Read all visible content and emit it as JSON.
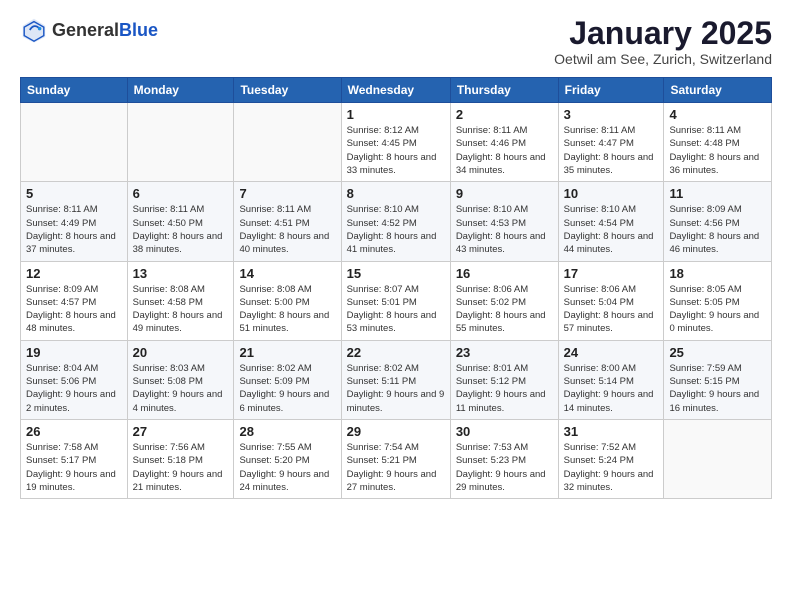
{
  "header": {
    "logo_general": "General",
    "logo_blue": "Blue",
    "month_title": "January 2025",
    "location": "Oetwil am See, Zurich, Switzerland"
  },
  "calendar": {
    "days_of_week": [
      "Sunday",
      "Monday",
      "Tuesday",
      "Wednesday",
      "Thursday",
      "Friday",
      "Saturday"
    ],
    "weeks": [
      [
        {
          "day": "",
          "info": ""
        },
        {
          "day": "",
          "info": ""
        },
        {
          "day": "",
          "info": ""
        },
        {
          "day": "1",
          "info": "Sunrise: 8:12 AM\nSunset: 4:45 PM\nDaylight: 8 hours\nand 33 minutes."
        },
        {
          "day": "2",
          "info": "Sunrise: 8:11 AM\nSunset: 4:46 PM\nDaylight: 8 hours\nand 34 minutes."
        },
        {
          "day": "3",
          "info": "Sunrise: 8:11 AM\nSunset: 4:47 PM\nDaylight: 8 hours\nand 35 minutes."
        },
        {
          "day": "4",
          "info": "Sunrise: 8:11 AM\nSunset: 4:48 PM\nDaylight: 8 hours\nand 36 minutes."
        }
      ],
      [
        {
          "day": "5",
          "info": "Sunrise: 8:11 AM\nSunset: 4:49 PM\nDaylight: 8 hours\nand 37 minutes."
        },
        {
          "day": "6",
          "info": "Sunrise: 8:11 AM\nSunset: 4:50 PM\nDaylight: 8 hours\nand 38 minutes."
        },
        {
          "day": "7",
          "info": "Sunrise: 8:11 AM\nSunset: 4:51 PM\nDaylight: 8 hours\nand 40 minutes."
        },
        {
          "day": "8",
          "info": "Sunrise: 8:10 AM\nSunset: 4:52 PM\nDaylight: 8 hours\nand 41 minutes."
        },
        {
          "day": "9",
          "info": "Sunrise: 8:10 AM\nSunset: 4:53 PM\nDaylight: 8 hours\nand 43 minutes."
        },
        {
          "day": "10",
          "info": "Sunrise: 8:10 AM\nSunset: 4:54 PM\nDaylight: 8 hours\nand 44 minutes."
        },
        {
          "day": "11",
          "info": "Sunrise: 8:09 AM\nSunset: 4:56 PM\nDaylight: 8 hours\nand 46 minutes."
        }
      ],
      [
        {
          "day": "12",
          "info": "Sunrise: 8:09 AM\nSunset: 4:57 PM\nDaylight: 8 hours\nand 48 minutes."
        },
        {
          "day": "13",
          "info": "Sunrise: 8:08 AM\nSunset: 4:58 PM\nDaylight: 8 hours\nand 49 minutes."
        },
        {
          "day": "14",
          "info": "Sunrise: 8:08 AM\nSunset: 5:00 PM\nDaylight: 8 hours\nand 51 minutes."
        },
        {
          "day": "15",
          "info": "Sunrise: 8:07 AM\nSunset: 5:01 PM\nDaylight: 8 hours\nand 53 minutes."
        },
        {
          "day": "16",
          "info": "Sunrise: 8:06 AM\nSunset: 5:02 PM\nDaylight: 8 hours\nand 55 minutes."
        },
        {
          "day": "17",
          "info": "Sunrise: 8:06 AM\nSunset: 5:04 PM\nDaylight: 8 hours\nand 57 minutes."
        },
        {
          "day": "18",
          "info": "Sunrise: 8:05 AM\nSunset: 5:05 PM\nDaylight: 9 hours\nand 0 minutes."
        }
      ],
      [
        {
          "day": "19",
          "info": "Sunrise: 8:04 AM\nSunset: 5:06 PM\nDaylight: 9 hours\nand 2 minutes."
        },
        {
          "day": "20",
          "info": "Sunrise: 8:03 AM\nSunset: 5:08 PM\nDaylight: 9 hours\nand 4 minutes."
        },
        {
          "day": "21",
          "info": "Sunrise: 8:02 AM\nSunset: 5:09 PM\nDaylight: 9 hours\nand 6 minutes."
        },
        {
          "day": "22",
          "info": "Sunrise: 8:02 AM\nSunset: 5:11 PM\nDaylight: 9 hours\nand 9 minutes."
        },
        {
          "day": "23",
          "info": "Sunrise: 8:01 AM\nSunset: 5:12 PM\nDaylight: 9 hours\nand 11 minutes."
        },
        {
          "day": "24",
          "info": "Sunrise: 8:00 AM\nSunset: 5:14 PM\nDaylight: 9 hours\nand 14 minutes."
        },
        {
          "day": "25",
          "info": "Sunrise: 7:59 AM\nSunset: 5:15 PM\nDaylight: 9 hours\nand 16 minutes."
        }
      ],
      [
        {
          "day": "26",
          "info": "Sunrise: 7:58 AM\nSunset: 5:17 PM\nDaylight: 9 hours\nand 19 minutes."
        },
        {
          "day": "27",
          "info": "Sunrise: 7:56 AM\nSunset: 5:18 PM\nDaylight: 9 hours\nand 21 minutes."
        },
        {
          "day": "28",
          "info": "Sunrise: 7:55 AM\nSunset: 5:20 PM\nDaylight: 9 hours\nand 24 minutes."
        },
        {
          "day": "29",
          "info": "Sunrise: 7:54 AM\nSunset: 5:21 PM\nDaylight: 9 hours\nand 27 minutes."
        },
        {
          "day": "30",
          "info": "Sunrise: 7:53 AM\nSunset: 5:23 PM\nDaylight: 9 hours\nand 29 minutes."
        },
        {
          "day": "31",
          "info": "Sunrise: 7:52 AM\nSunset: 5:24 PM\nDaylight: 9 hours\nand 32 minutes."
        },
        {
          "day": "",
          "info": ""
        }
      ]
    ]
  }
}
